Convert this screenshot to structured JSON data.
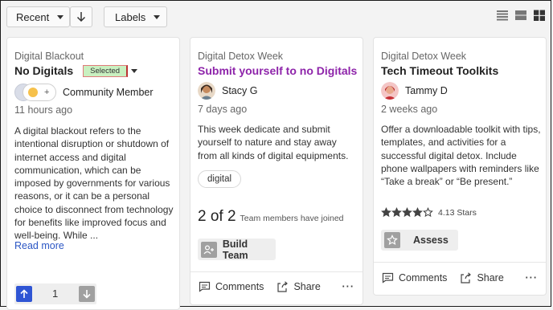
{
  "toolbar": {
    "sort_label": "Recent",
    "labels_label": "Labels",
    "view_icons": [
      "list-view-icon",
      "compact-view-icon",
      "grid-view-icon"
    ]
  },
  "cards": [
    {
      "category": "Digital Blackout",
      "title": "No Digitals",
      "status_badge": "Selected",
      "author": "Community Member",
      "time": "11 hours ago",
      "body": "A digital blackout refers to the intentional disruption or shutdown of internet access and digital communication, which can be imposed by governments for various reasons, or it can be a personal choice to disconnect from technology for benefits like improved focus and well-being. While ...",
      "read_more": "Read more",
      "vote_count": "1",
      "reaction_add": "+"
    },
    {
      "category": "Digital Detox Week",
      "title": "Submit yourself to no Digitals",
      "author": "Stacy G",
      "time": "7 days ago",
      "body": "This week dedicate and submit yourself to nature and stay away from all kinds of digital equipments.",
      "tag": "digital",
      "team_count": "2 of 2",
      "team_note": "Team members have joined",
      "build_team_label": "Build Team",
      "comments_label": "Comments",
      "share_label": "Share",
      "more_label": "···"
    },
    {
      "category": "Digital Detox Week",
      "title": "Tech Timeout Toolkits",
      "author": "Tammy D",
      "time": "2 weeks ago",
      "body": "Offer a downloadable toolkit with tips, templates, and activities for a successful digital detox. Include phone wallpapers with reminders like “Take a break” or “Be present.”",
      "rating": 4.13,
      "rating_text": "4.13 Stars",
      "assess_label": "Assess",
      "comments_label": "Comments",
      "share_label": "Share",
      "more_label": "···"
    }
  ],
  "colors": {
    "accent_purple": "#8e24aa",
    "link_blue": "#2b56c4",
    "upvote_blue": "#2f55d4",
    "badge_green": "#c9f0c0"
  }
}
